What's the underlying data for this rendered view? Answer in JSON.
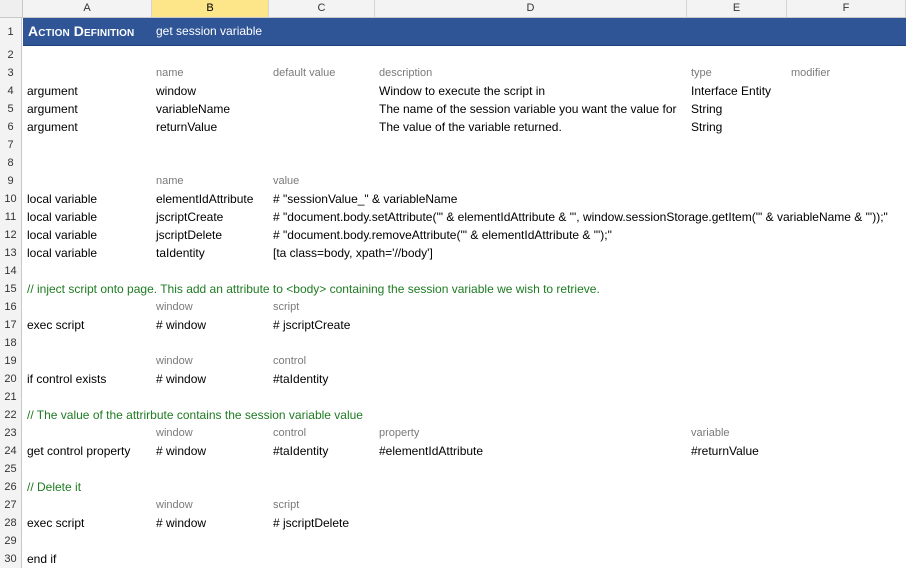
{
  "columns": [
    {
      "letter": "A"
    },
    {
      "letter": "B"
    },
    {
      "letter": "C"
    },
    {
      "letter": "D"
    },
    {
      "letter": "E"
    },
    {
      "letter": "F"
    }
  ],
  "title": {
    "main": "Action Definition",
    "sub": "get session variable"
  },
  "rows": [
    {
      "n": "1"
    },
    {
      "n": "2"
    },
    {
      "n": "3",
      "type": "header",
      "cells": {
        "B": "name",
        "C": "default value",
        "D": "description",
        "E": "type",
        "F": "modifier"
      }
    },
    {
      "n": "4",
      "cells": {
        "A": "argument",
        "B": "window",
        "D": "Window to execute the script in",
        "E": "Interface Entity"
      }
    },
    {
      "n": "5",
      "cells": {
        "A": "argument",
        "B": "variableName",
        "D": "The name of the session variable you want the value for",
        "E": "String"
      }
    },
    {
      "n": "6",
      "cells": {
        "A": "argument",
        "B": "returnValue",
        "D": "The value of the variable returned.",
        "E": "String"
      }
    },
    {
      "n": "7"
    },
    {
      "n": "8"
    },
    {
      "n": "9",
      "type": "header",
      "cells": {
        "B": "name",
        "C": "value"
      }
    },
    {
      "n": "10",
      "cells": {
        "A": "local variable",
        "B": "elementIdAttribute",
        "C": "# \"sessionValue_\" & variableName"
      }
    },
    {
      "n": "11",
      "cells": {
        "A": "local variable",
        "B": "jscriptCreate",
        "C": "# \"document.body.setAttribute('\" & elementIdAttribute & \"', window.sessionStorage.getItem('\" & variableName & \"'));\""
      }
    },
    {
      "n": "12",
      "cells": {
        "A": "local variable",
        "B": "jscriptDelete",
        "C": "# \"document.body.removeAttribute('\" & elementIdAttribute & \"');\""
      }
    },
    {
      "n": "13",
      "cells": {
        "A": "local variable",
        "B": "taIdentity",
        "C": "[ta class=body, xpath='//body']"
      }
    },
    {
      "n": "14"
    },
    {
      "n": "15",
      "type": "comment",
      "cells": {
        "A": "// inject script onto page. This add an attribute to <body> containing the session variable we wish to retrieve."
      }
    },
    {
      "n": "16",
      "type": "header",
      "cells": {
        "B": "window",
        "C": "script"
      }
    },
    {
      "n": "17",
      "cells": {
        "A": "exec script",
        "B": "# window",
        "C": "# jscriptCreate"
      }
    },
    {
      "n": "18"
    },
    {
      "n": "19",
      "type": "header",
      "cells": {
        "B": "window",
        "C": "control"
      }
    },
    {
      "n": "20",
      "cells": {
        "A": "if control exists",
        "B": "# window",
        "C": "#taIdentity"
      }
    },
    {
      "n": "21"
    },
    {
      "n": "22",
      "type": "comment",
      "cells": {
        "A": "// The value of the attrirbute contains the session variable value"
      }
    },
    {
      "n": "23",
      "type": "header",
      "cells": {
        "B": "window",
        "C": "control",
        "D": "property",
        "E": "variable"
      }
    },
    {
      "n": "24",
      "cells": {
        "A": "get control property",
        "B": "# window",
        "C": "#taIdentity",
        "D": "#elementIdAttribute",
        "E": "#returnValue"
      }
    },
    {
      "n": "25"
    },
    {
      "n": "26",
      "type": "comment",
      "cells": {
        "A": "// Delete it"
      }
    },
    {
      "n": "27",
      "type": "header",
      "cells": {
        "B": "window",
        "C": "script"
      }
    },
    {
      "n": "28",
      "cells": {
        "A": "exec script",
        "B": "# window",
        "C": "# jscriptDelete"
      }
    },
    {
      "n": "29"
    },
    {
      "n": "30",
      "cells": {
        "A": "end if"
      }
    }
  ],
  "colors": {
    "title_bg": "#2f5597",
    "comment": "#1e7b22",
    "header_text": "#7a7a7a",
    "selected_col": "#fde68a"
  }
}
